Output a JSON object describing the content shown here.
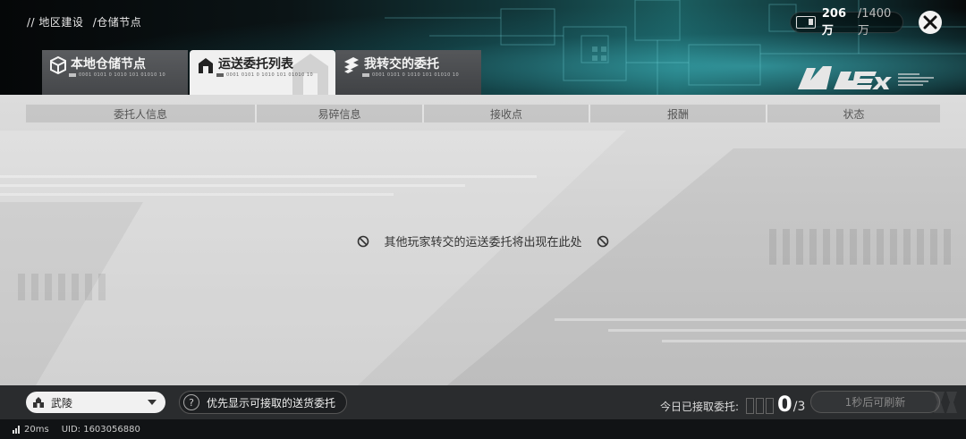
{
  "breadcrumb": {
    "part1": "// 地区建设",
    "part2": "/仓储节点"
  },
  "currency": {
    "current": "206万",
    "max": "/1400万",
    "icon": "storage-icon"
  },
  "tabs": [
    {
      "label": "本地仓储节点",
      "code": "0001 0101 0 1010 101 01010 10",
      "icon": "cube-icon"
    },
    {
      "label": "运送委托列表",
      "code": "0001 0101 0 1010 101 01010 10",
      "icon": "house-icon"
    },
    {
      "label": "我转交的委托",
      "code": "0001 0101 0 1010 101 01010 10",
      "icon": "transfer-icon"
    }
  ],
  "table": {
    "columns": [
      "委托人信息",
      "易碎信息",
      "接收点",
      "报酬",
      "状态"
    ]
  },
  "empty_message": "其他玩家转交的运送委托将出现在此处",
  "footer": {
    "region": "武陵",
    "priority_label": "优先显示可接取的送货委托",
    "accepted_label": "今日已接取委托:",
    "accepted_count": "0",
    "accepted_total": "/3",
    "refresh_label": "1秒后可刷新"
  },
  "status": {
    "ping": "20ms",
    "uid": "UID: 1603056880"
  },
  "colors": {
    "accent": "#46c8d2",
    "active_tab": "#f0f0f0",
    "content_bg": "#d3d3d3"
  }
}
